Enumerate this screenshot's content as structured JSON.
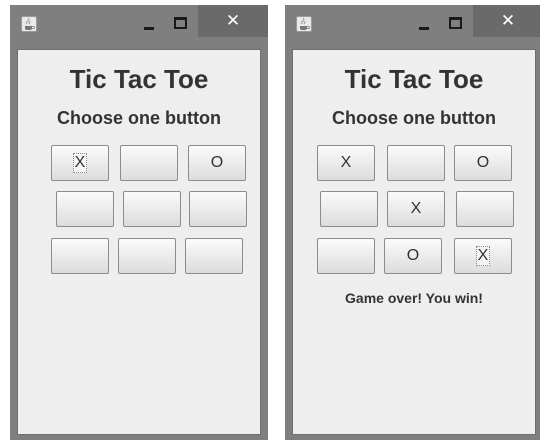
{
  "windows": [
    {
      "title_icon": "java-cup-icon",
      "close_label": "✕",
      "heading": "Tic Tac Toe",
      "prompt": "Choose one button",
      "cells": [
        "X",
        "",
        "O",
        "",
        "",
        "",
        "",
        "",
        ""
      ],
      "status": ""
    },
    {
      "title_icon": "java-cup-icon",
      "close_label": "✕",
      "heading": "Tic Tac Toe",
      "prompt": "Choose one button",
      "cells": [
        "X",
        "",
        "O",
        "",
        "X",
        "",
        "",
        "O",
        "X"
      ],
      "status": "Game over! You win!"
    }
  ]
}
